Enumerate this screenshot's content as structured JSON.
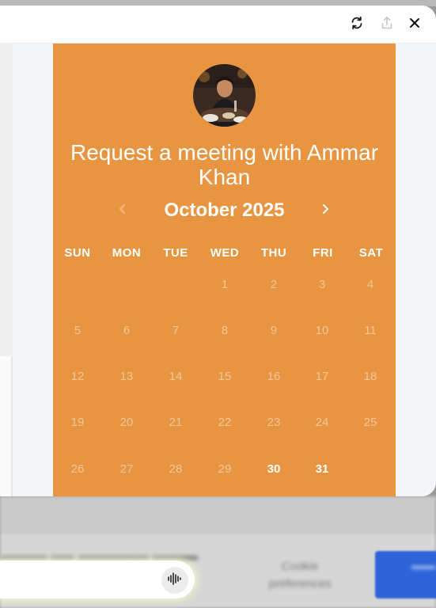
{
  "modal": {
    "header_icons": [
      "refresh-icon",
      "share-icon",
      "close-icon"
    ]
  },
  "booking": {
    "title": "Request a meeting with Ammar Khan",
    "month_label": "October 2025",
    "prev_icon": "chevron-left-icon",
    "next_icon": "chevron-right-icon",
    "accent_color": "#e89541",
    "weekdays": [
      "SUN",
      "MON",
      "TUE",
      "WED",
      "THU",
      "FRI",
      "SAT"
    ],
    "weeks": [
      [
        null,
        null,
        null,
        {
          "d": "1",
          "available": false
        },
        {
          "d": "2",
          "available": false
        },
        {
          "d": "3",
          "available": false
        },
        {
          "d": "4",
          "available": false
        }
      ],
      [
        {
          "d": "5",
          "available": false
        },
        {
          "d": "6",
          "available": false
        },
        {
          "d": "7",
          "available": false
        },
        {
          "d": "8",
          "available": false
        },
        {
          "d": "9",
          "available": false
        },
        {
          "d": "10",
          "available": false
        },
        {
          "d": "11",
          "available": false
        }
      ],
      [
        {
          "d": "12",
          "available": false
        },
        {
          "d": "13",
          "available": false
        },
        {
          "d": "14",
          "available": false
        },
        {
          "d": "15",
          "available": false
        },
        {
          "d": "16",
          "available": false
        },
        {
          "d": "17",
          "available": false
        },
        {
          "d": "18",
          "available": false
        }
      ],
      [
        {
          "d": "19",
          "available": false
        },
        {
          "d": "20",
          "available": false
        },
        {
          "d": "21",
          "available": false
        },
        {
          "d": "22",
          "available": false
        },
        {
          "d": "23",
          "available": false
        },
        {
          "d": "24",
          "available": false
        },
        {
          "d": "25",
          "available": false
        }
      ],
      [
        {
          "d": "26",
          "available": false
        },
        {
          "d": "27",
          "available": false
        },
        {
          "d": "28",
          "available": false
        },
        {
          "d": "29",
          "available": false
        },
        {
          "d": "30",
          "available": true
        },
        {
          "d": "31",
          "available": true
        },
        null
      ]
    ]
  },
  "background": {
    "voice_icon": "voice-waveform-icon",
    "blurred_label_1": "Cookie preferences"
  }
}
